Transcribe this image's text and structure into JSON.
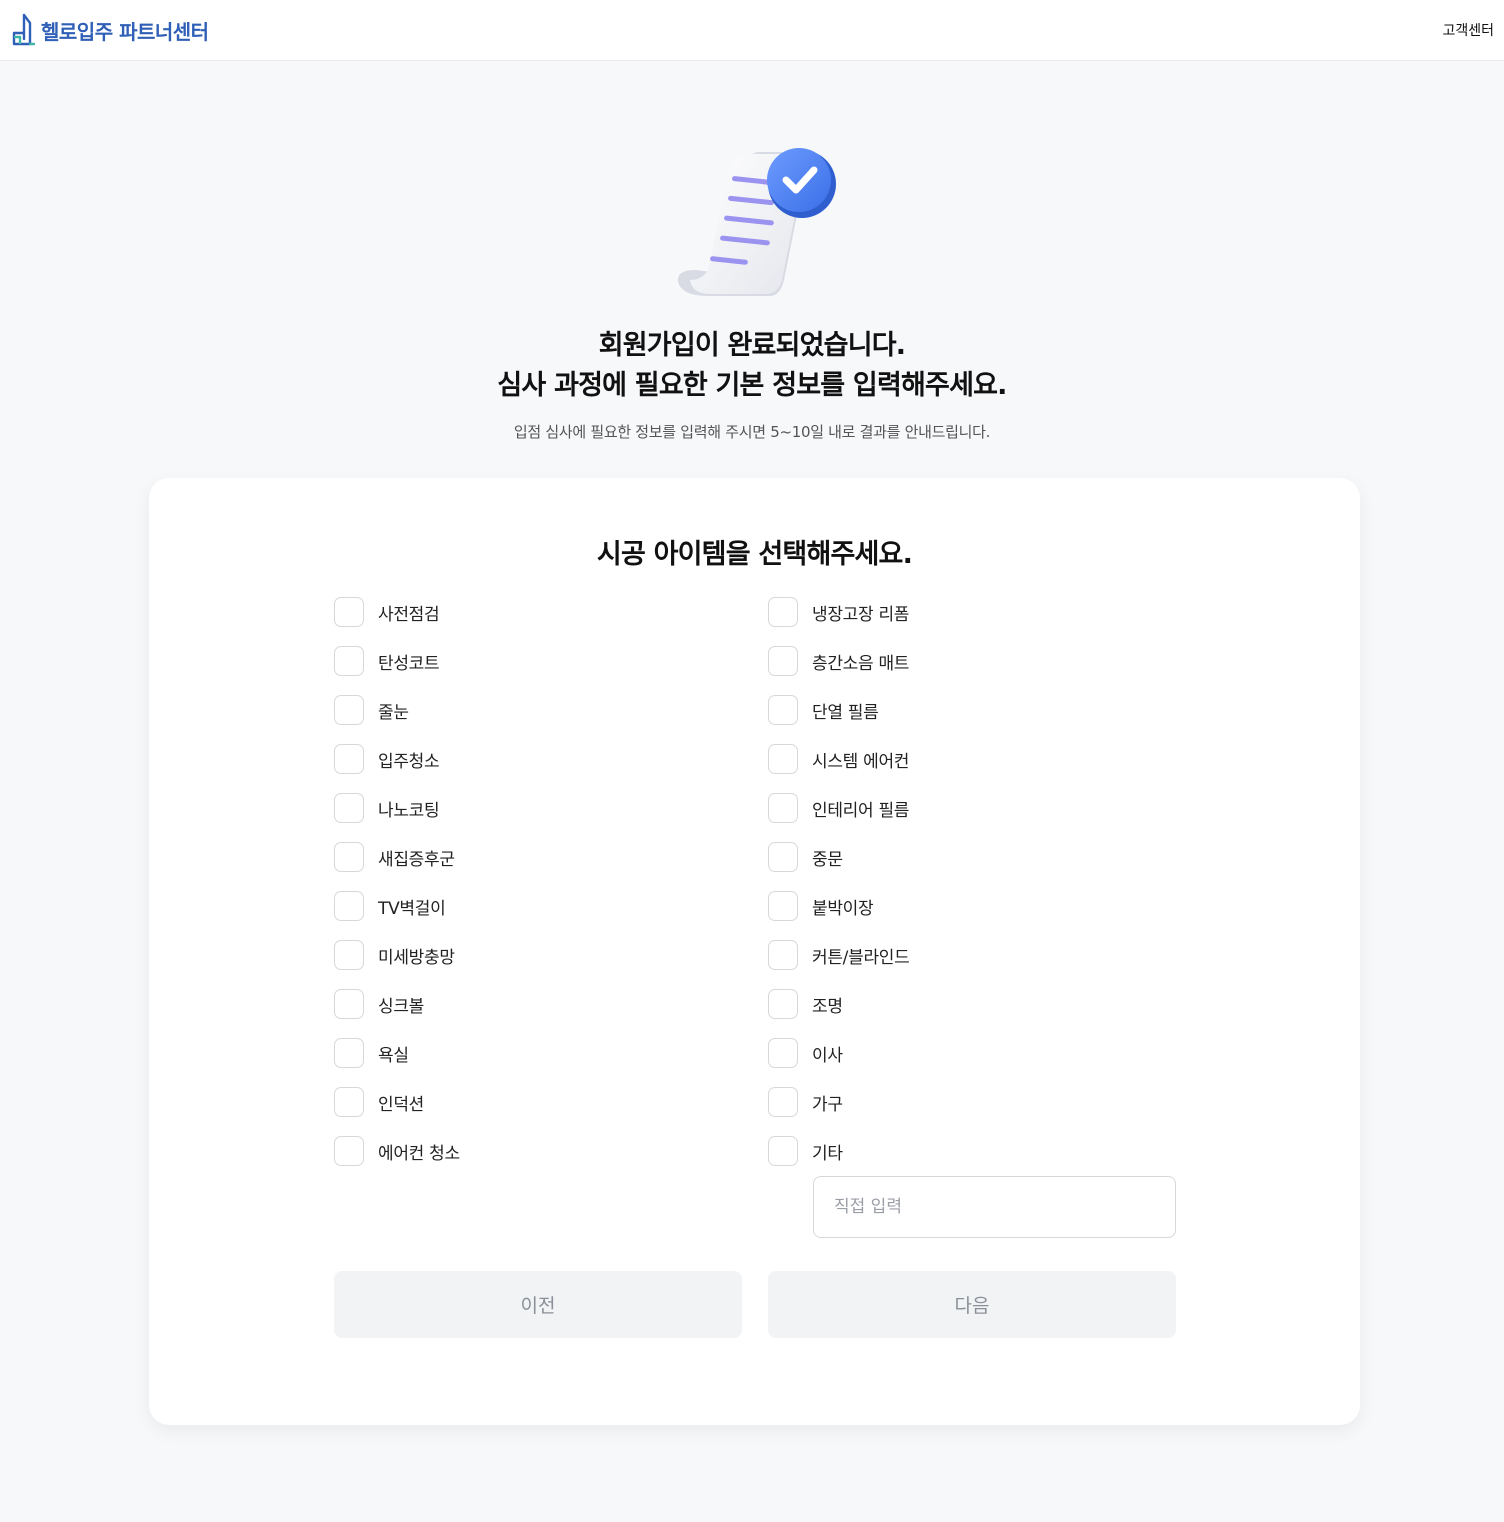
{
  "header": {
    "brand": "헬로입주 파트너센터",
    "support_link": "고객센터"
  },
  "hero": {
    "headline_line1": "회원가입이 완료되었습니다.",
    "headline_line2": "심사 과정에 필요한 기본 정보를 입력해주세요.",
    "subtext": "입점 심사에 필요한 정보를 입력해 주시면 5~10일 내로 결과를 안내드립니다."
  },
  "form": {
    "title": "시공 아이템을 선택해주세요.",
    "left_items": [
      "사전점검",
      "탄성코트",
      "줄눈",
      "입주청소",
      "나노코팅",
      "새집증후군",
      "TV벽걸이",
      "미세방충망",
      "싱크볼",
      "욕실",
      "인덕션",
      "에어컨 청소"
    ],
    "right_items": [
      "냉장고장 리폼",
      "층간소음 매트",
      "단열 필름",
      "시스템 에어컨",
      "인테리어 필름",
      "중문",
      "붙박이장",
      "커튼/블라인드",
      "조명",
      "이사",
      "가구",
      "기타"
    ],
    "etc_placeholder": "직접 입력",
    "etc_value": "",
    "prev_label": "이전",
    "next_label": "다음"
  },
  "colors": {
    "brand": "#2f5fb6",
    "background": "#f7f8fa",
    "button_bg": "#f2f3f5",
    "button_text": "#8b9098"
  }
}
